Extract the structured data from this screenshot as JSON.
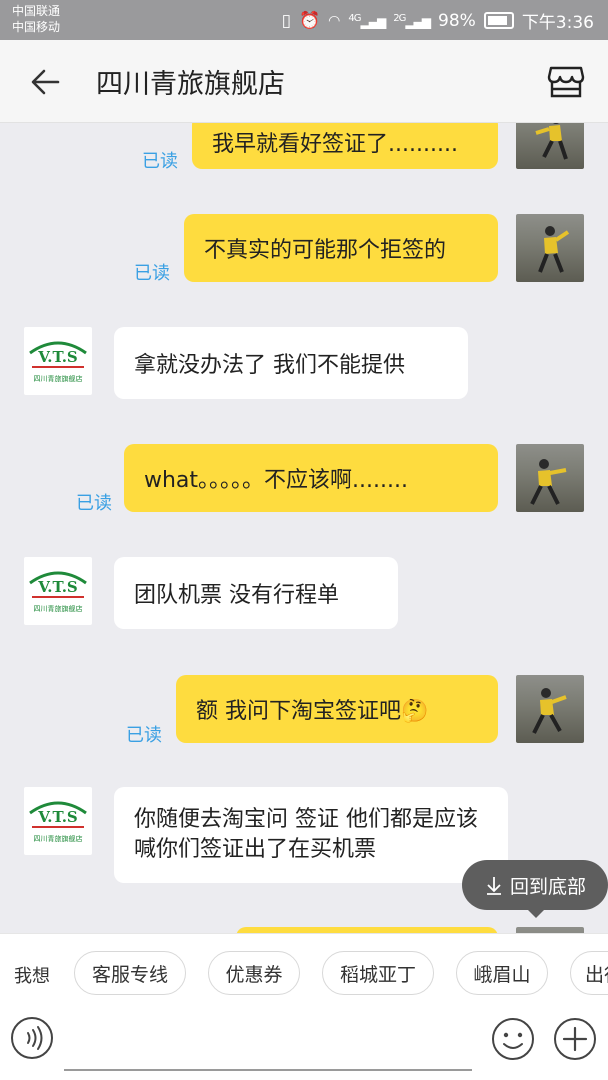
{
  "status_bar": {
    "carrier_1": "中国联通",
    "carrier_2": "中国移动",
    "network_1": "4G",
    "network_2": "2G",
    "battery": "98%",
    "time": "下午3:36"
  },
  "header": {
    "title": "四川青旅旗舰店",
    "back_icon": "arrow-left-icon",
    "store_icon": "store-icon"
  },
  "messages": [
    {
      "sender": "me",
      "text": "我早就看好签证了..........",
      "read": "已读"
    },
    {
      "sender": "me",
      "text": "不真实的可能那个拒签的",
      "read": "已读"
    },
    {
      "sender": "shop",
      "text": "拿就没办法了 我们不能提供"
    },
    {
      "sender": "me",
      "text": "what。。。。。不应该啊........",
      "read": "已读"
    },
    {
      "sender": "shop",
      "text": "团队机票 没有行程单"
    },
    {
      "sender": "me",
      "text": "额    我问下淘宝签证吧🤔",
      "read": "已读"
    },
    {
      "sender": "shop",
      "text": "你随便去淘宝问 签证 他们都是应该喊你们签证出了在买机票"
    }
  ],
  "shop_logo_text": "四川青旅旗舰店",
  "scroll_bottom": {
    "label": "回到底部",
    "icon": "arrow-down-icon"
  },
  "quick_replies": {
    "label": "我想",
    "items": [
      "客服专线",
      "优惠券",
      "稻城亚丁",
      "峨眉山",
      "出行"
    ]
  },
  "input": {
    "placeholder": "",
    "value": ""
  },
  "colors": {
    "my_bubble": "#fedc3f",
    "read_text": "#3aa0e3",
    "shop_green": "#1f8a3a",
    "shop_red": "#d0312d"
  }
}
